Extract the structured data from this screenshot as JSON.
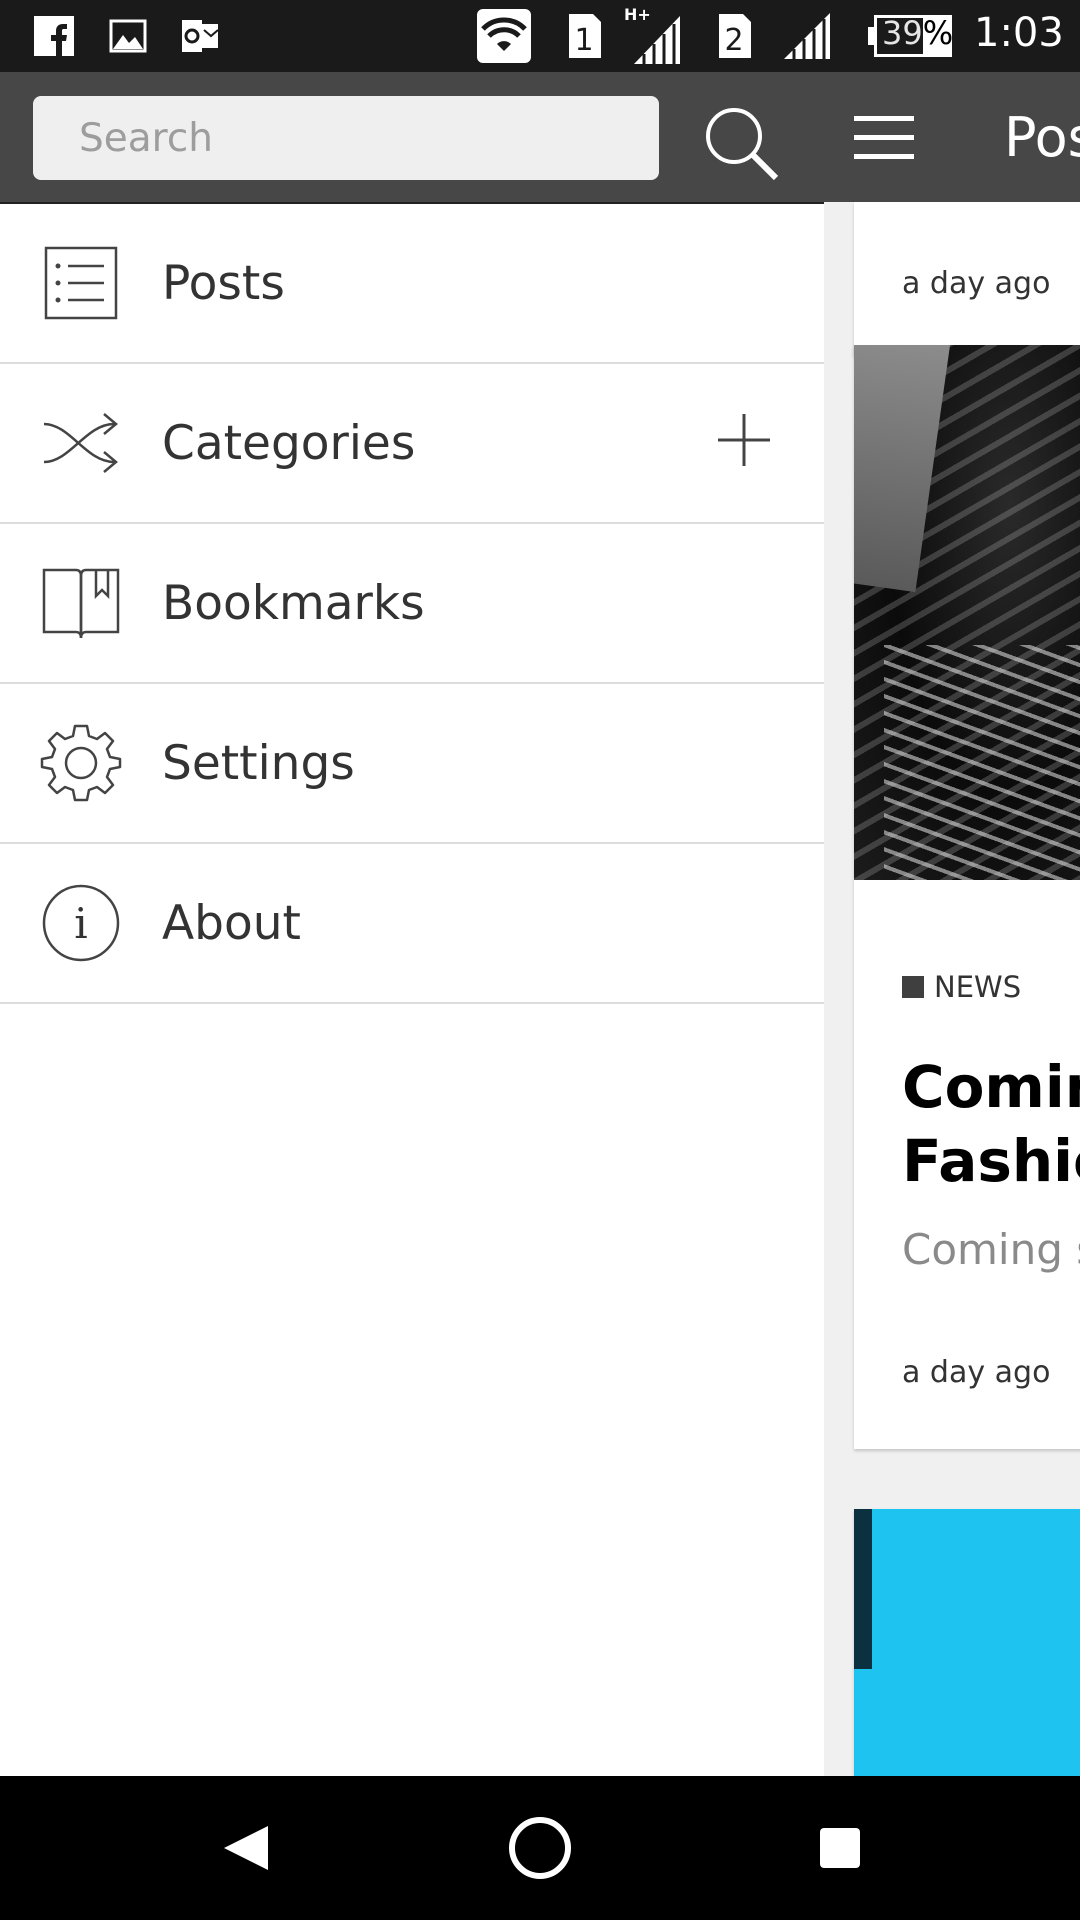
{
  "status_bar": {
    "icons": [
      "facebook-icon",
      "image-icon",
      "outlook-icon",
      "wifi-icon",
      "sim1-signal-icon",
      "sim2-signal-icon",
      "battery-icon"
    ],
    "sim1_label": "1",
    "network_type": "H+",
    "sim2_label": "2",
    "battery": "39%",
    "time": "1:03"
  },
  "drawer": {
    "search": {
      "placeholder": "Search",
      "icon": "search-icon"
    },
    "items": [
      {
        "label": "Posts",
        "icon": "list-icon"
      },
      {
        "label": "Categories",
        "icon": "shuffle-icon",
        "action_icon": "plus-icon"
      },
      {
        "label": "Bookmarks",
        "icon": "book-bookmark-icon"
      },
      {
        "label": "Settings",
        "icon": "gear-icon"
      },
      {
        "label": "About",
        "icon": "info-icon"
      }
    ]
  },
  "main": {
    "toolbar": {
      "title": "Posts",
      "menu_icon": "hamburger-icon"
    },
    "cards": [
      {
        "time": "a day ago"
      },
      {
        "category": "NEWS",
        "title_line1": "Coming",
        "title_line2": "Fashion",
        "excerpt": "Coming so",
        "time": "a day ago"
      },
      {
        "image_color": "#1ec3f0"
      }
    ]
  },
  "nav_bar": {
    "icons": [
      "back-icon",
      "home-icon",
      "recents-icon"
    ]
  },
  "colors": {
    "header": "#474747",
    "status_bar": "#1a1a1a",
    "nav_bar": "#000000",
    "accent_image": "#1ec3f0"
  }
}
